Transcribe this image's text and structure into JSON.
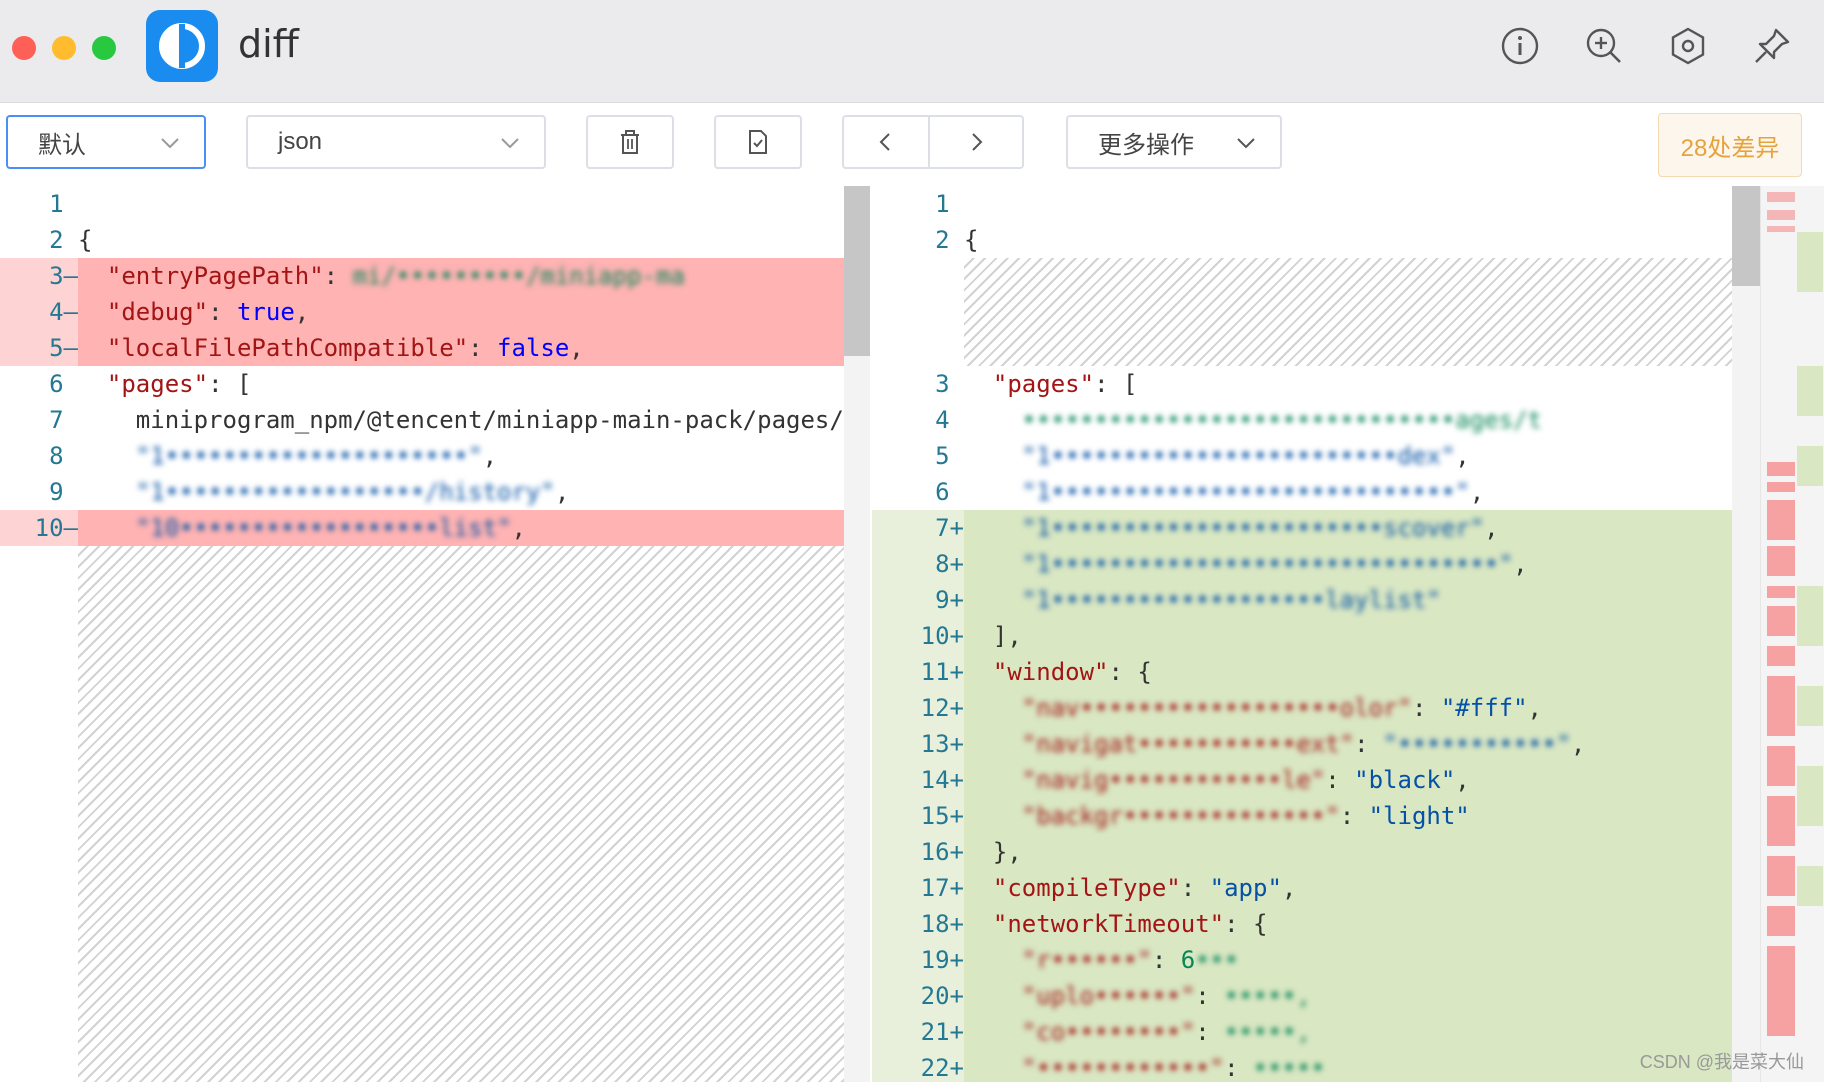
{
  "window": {
    "title": "diff",
    "toolbar_icons": [
      "info-icon",
      "zoom-in-icon",
      "settings-icon",
      "pin-icon"
    ]
  },
  "toolbar": {
    "compare_mode": "默认",
    "language": "json",
    "delete_icon": "trash-icon",
    "file_icon": "file-icon",
    "prev_icon": "chevron-left-icon",
    "next_icon": "chevron-right-icon",
    "more_actions": "更多操作",
    "diff_count": "28处差异"
  },
  "colors": {
    "deleted": "#ffb3b3",
    "added": "#d9e7c3",
    "accent": "#1a8cf0",
    "badge_text": "#e6a23c"
  },
  "left_lines": [
    {
      "num": "1",
      "marker": "",
      "code": ""
    },
    {
      "num": "2",
      "marker": "",
      "code": "{"
    },
    {
      "num": "3",
      "marker": "—",
      "code": "  \"entryPagePath\": \"mi/▓▓▓▓▓▓▓▓▓/miniapp-ma"
    },
    {
      "num": "4",
      "marker": "—",
      "code": "  \"debug\": true,"
    },
    {
      "num": "5",
      "marker": "—",
      "code": "  \"localFilePathCompatible\": false,"
    },
    {
      "num": "6",
      "marker": "",
      "code": "  \"pages\": ["
    },
    {
      "num": "7",
      "marker": "",
      "code": "    \"miniprogram_npm/@tencent/miniapp-main-pack/pages/t"
    },
    {
      "num": "8",
      "marker": "",
      "code": "    \"1▓▓▓▓▓▓▓▓▓▓▓▓▓▓▓▓▓▓▓▓▓\","
    },
    {
      "num": "9",
      "marker": "",
      "code": "    \"1▓▓▓▓▓▓▓▓▓▓▓▓▓▓▓▓▓▓/history\","
    },
    {
      "num": "10",
      "marker": "—",
      "code": "    \"10▓▓▓▓▓▓▓▓▓▓▓▓▓▓▓▓▓▓list\","
    }
  ],
  "right_lines": [
    {
      "num": "1",
      "marker": "",
      "code": ""
    },
    {
      "num": "2",
      "marker": "",
      "code": "{"
    },
    {
      "num": "3",
      "marker": "",
      "code": "  \"pages\": ["
    },
    {
      "num": "4",
      "marker": "",
      "code": "    \"▓▓▓▓▓▓▓▓▓▓▓▓▓▓▓▓▓▓▓▓▓▓▓▓▓▓▓▓▓▓ages/t"
    },
    {
      "num": "5",
      "marker": "",
      "code": "    \"1▓▓▓▓▓▓▓▓▓▓▓▓▓▓▓▓▓▓▓▓▓▓▓▓dex\","
    },
    {
      "num": "6",
      "marker": "",
      "code": "    \"1▓▓▓▓▓▓▓▓▓▓▓▓▓▓▓▓▓▓▓▓▓▓▓▓▓▓▓▓\","
    },
    {
      "num": "7",
      "marker": "+",
      "code": "    \"1▓▓▓▓▓▓▓▓▓▓▓▓▓▓▓▓▓▓▓▓▓▓▓scover\","
    },
    {
      "num": "8",
      "marker": "+",
      "code": "    \"1▓▓▓▓▓▓▓▓▓▓▓▓▓▓▓▓▓▓▓▓▓▓▓▓▓▓▓▓▓▓▓\","
    },
    {
      "num": "9",
      "marker": "+",
      "code": "    \"1▓▓▓▓▓▓▓▓▓▓▓▓▓▓▓▓▓▓▓laylist\""
    },
    {
      "num": "10",
      "marker": "+",
      "code": "  ],"
    },
    {
      "num": "11",
      "marker": "+",
      "code": "  \"window\": {"
    },
    {
      "num": "12",
      "marker": "+",
      "code": "    \"nav▓▓▓▓▓▓▓▓▓▓▓▓▓▓▓▓▓▓olor\": \"#fff\","
    },
    {
      "num": "13",
      "marker": "+",
      "code": "    \"navigat▓▓▓▓▓▓▓▓▓▓▓ext\": \"▓▓▓▓▓▓▓▓▓▓▓\","
    },
    {
      "num": "14",
      "marker": "+",
      "code": "    \"navig▓▓▓▓▓▓▓▓▓▓▓▓le\": \"black\","
    },
    {
      "num": "15",
      "marker": "+",
      "code": "    \"backgr▓▓▓▓▓▓▓▓▓▓▓▓▓▓\": \"light\""
    },
    {
      "num": "16",
      "marker": "+",
      "code": "  },"
    },
    {
      "num": "17",
      "marker": "+",
      "code": "  \"compileType\": \"app\","
    },
    {
      "num": "18",
      "marker": "+",
      "code": "  \"networkTimeout\": {"
    },
    {
      "num": "19",
      "marker": "+",
      "code": "    \"r▓▓▓▓▓▓\": 6▓▓▓"
    },
    {
      "num": "20",
      "marker": "+",
      "code": "    \"uplo▓▓▓▓▓▓\": ▓▓▓▓▓,"
    },
    {
      "num": "21",
      "marker": "+",
      "code": "    \"co▓▓▓▓▓▓▓▓\": ▓▓▓▓▓,"
    },
    {
      "num": "22",
      "marker": "+",
      "code": "    \"▓▓▓▓▓▓▓▓▓▓▓▓\": ▓▓▓▓▓"
    }
  ],
  "watermark": "CSDN @我是菜大仙"
}
